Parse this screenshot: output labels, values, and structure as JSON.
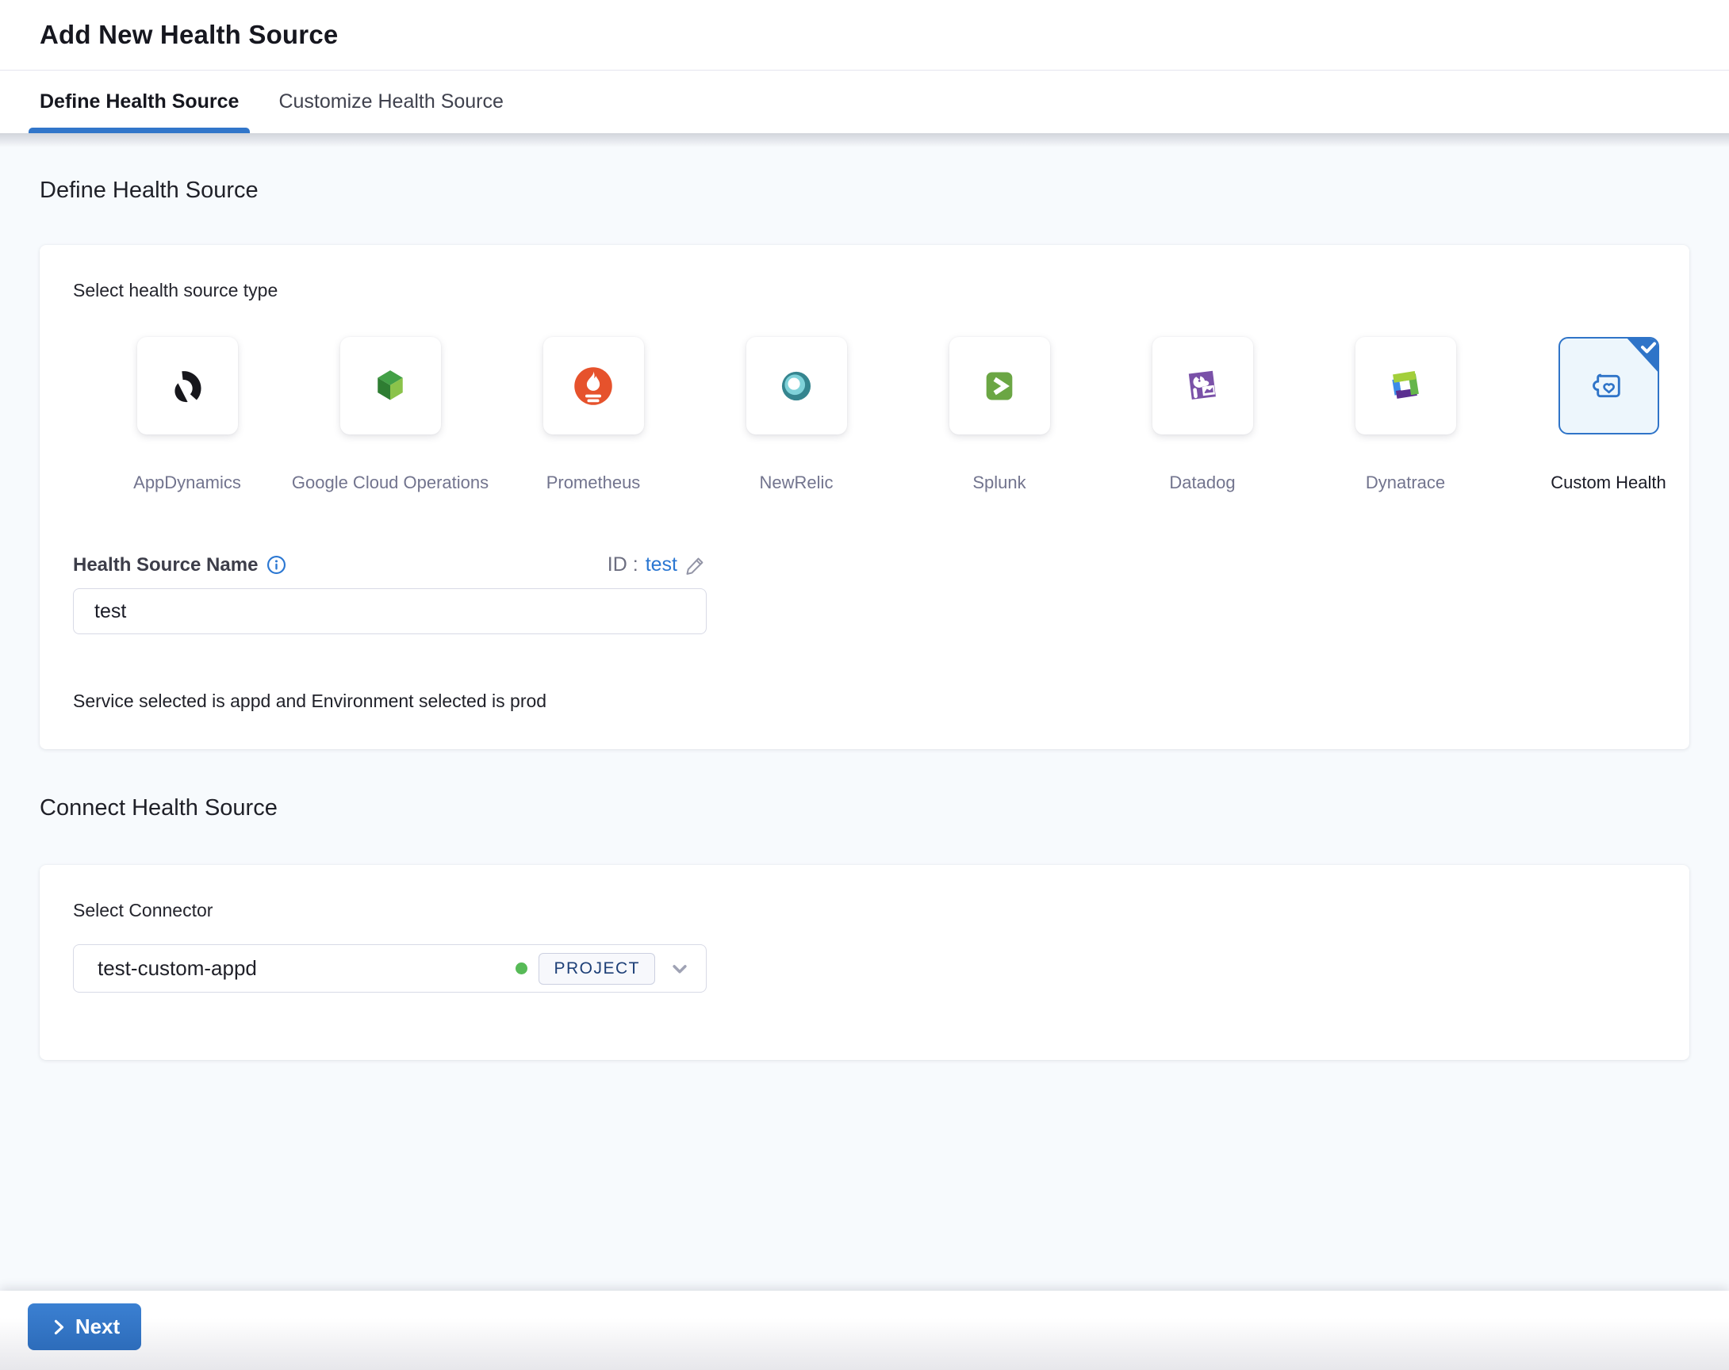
{
  "header": {
    "title": "Add New Health Source",
    "tabs": [
      {
        "label": "Define Health Source",
        "active": true
      },
      {
        "label": "Customize Health Source",
        "active": false
      }
    ]
  },
  "define_section": {
    "heading": "Define Health Source",
    "type_label": "Select health source type",
    "sources": [
      {
        "name": "AppDynamics",
        "icon": "appdynamics-icon",
        "selected": false
      },
      {
        "name": "Google Cloud Operations",
        "icon": "google-cloud-operations-icon",
        "selected": false
      },
      {
        "name": "Prometheus",
        "icon": "prometheus-icon",
        "selected": false
      },
      {
        "name": "NewRelic",
        "icon": "newrelic-icon",
        "selected": false
      },
      {
        "name": "Splunk",
        "icon": "splunk-icon",
        "selected": false
      },
      {
        "name": "Datadog",
        "icon": "datadog-icon",
        "selected": false
      },
      {
        "name": "Dynatrace",
        "icon": "dynatrace-icon",
        "selected": false
      },
      {
        "name": "Custom Health",
        "icon": "custom-health-icon",
        "selected": true
      }
    ],
    "name_field": {
      "label": "Health Source Name",
      "value": "test"
    },
    "id_row": {
      "prefix": "ID :",
      "value": "test"
    },
    "service_note": "Service selected is appd and Environment selected is prod"
  },
  "connect_section": {
    "heading": "Connect Health Source",
    "connector_label": "Select Connector",
    "connector": {
      "value": "test-custom-appd",
      "scope": "PROJECT",
      "status_color": "#57ba57"
    }
  },
  "footer": {
    "next_label": "Next"
  },
  "colors": {
    "accent_blue": "#3176ca",
    "selected_blue": "#2f74c8",
    "link_blue": "#2b77d2",
    "status_green": "#57ba57"
  }
}
